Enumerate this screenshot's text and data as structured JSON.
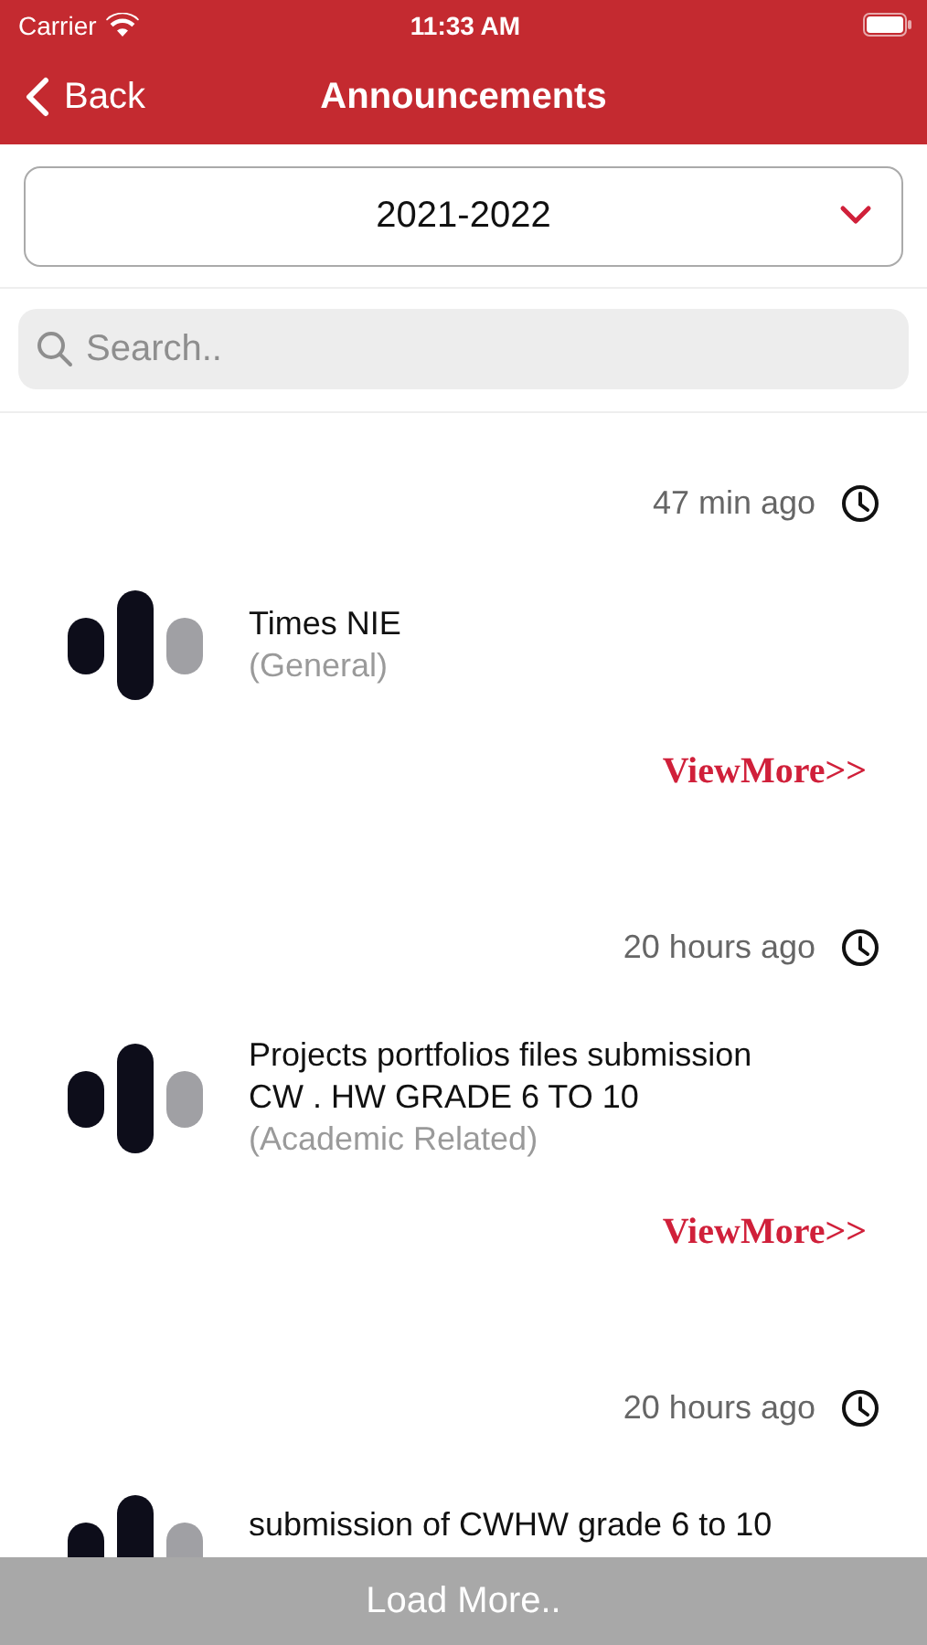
{
  "status_bar": {
    "carrier": "Carrier",
    "time": "11:33 AM"
  },
  "nav": {
    "back": "Back",
    "title": "Announcements"
  },
  "year_select": {
    "value": "2021-2022"
  },
  "search": {
    "placeholder": "Search.."
  },
  "announcements": [
    {
      "time": "47 min ago",
      "title": "Times NIE",
      "category": "(General)",
      "link": "ViewMore>>"
    },
    {
      "time": "20 hours ago",
      "title": "Projects portfolios files submission CW . HW GRADE 6 TO 10",
      "category": "(Academic Related)",
      "link": "ViewMore>>"
    },
    {
      "time": "20 hours ago",
      "title": "submission of CWHW grade 6 to 10"
    }
  ],
  "load_more": "Load More.."
}
